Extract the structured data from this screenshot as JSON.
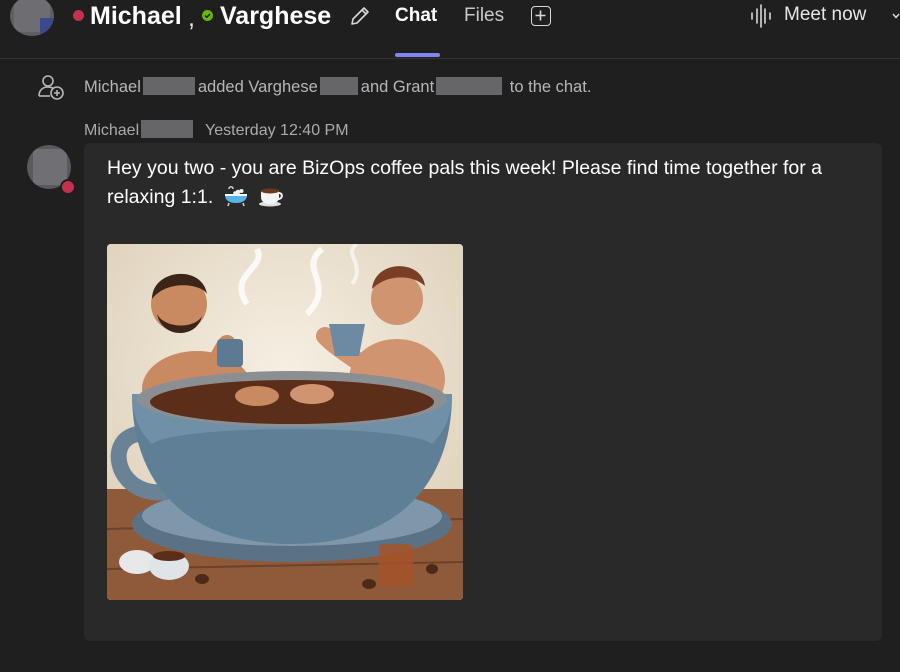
{
  "header": {
    "participants": [
      {
        "name": "Michael",
        "status_color": "#c4314b"
      },
      {
        "name": "Varghese",
        "status_color": "#6bb700"
      }
    ],
    "separator": ",",
    "tabs": [
      {
        "label": "Chat",
        "active": true
      },
      {
        "label": "Files",
        "active": false
      }
    ],
    "meet_now_label": "Meet now",
    "accent_color": "#7f85f5"
  },
  "system_message": {
    "actor": "Michael",
    "verb": "added",
    "person1": "Varghese",
    "conjunction": "and",
    "person2": "Grant",
    "suffix": "to the chat."
  },
  "message": {
    "sender": "Michael",
    "timestamp": "Yesterday 12:40 PM",
    "text": "Hey you two - you are BizOps coffee pals this week! Please find time together for a relaxing 1:1.",
    "emojis": [
      "bathtub-emoji",
      "coffee-cup-emoji"
    ],
    "sender_status_color": "#c4314b"
  },
  "icons": {
    "edit": "pencil-icon",
    "add_tab": "plus-icon",
    "meet": "audio-wave-icon",
    "people_added": "person-add-icon"
  }
}
